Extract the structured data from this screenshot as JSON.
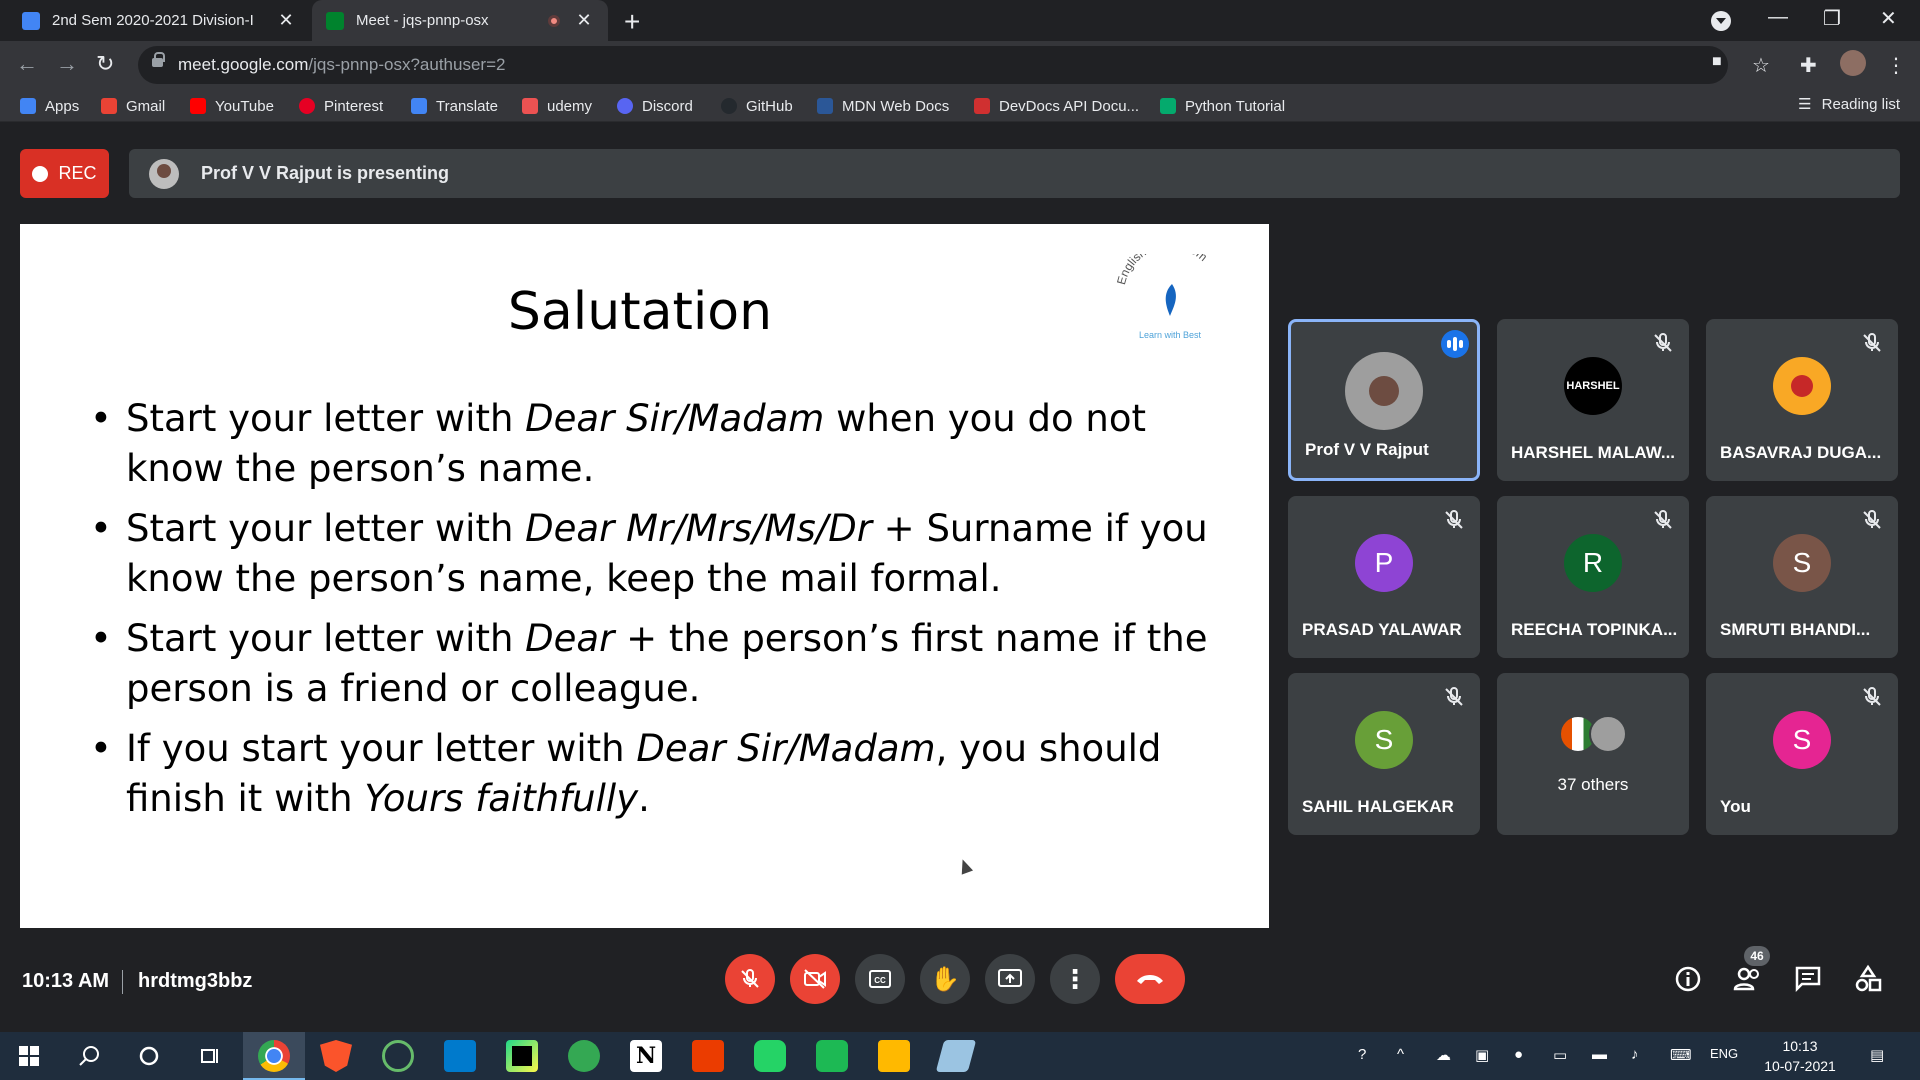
{
  "browser": {
    "tabs": [
      {
        "title": "2nd Sem 2020-2021 Division-I",
        "favicon_color": "#4285f4",
        "active": false
      },
      {
        "title": "Meet - jqs-pnnp-osx",
        "favicon_color": "#00832d",
        "active": true
      }
    ],
    "new_tab_label": "+",
    "url_host": "meet.google.com",
    "url_path": "/jqs-pnnp-osx?authuser=2",
    "bookmarks": [
      {
        "label": "Apps",
        "icon_color": "#4285f4"
      },
      {
        "label": "Gmail",
        "icon_color": "#ea4335"
      },
      {
        "label": "YouTube",
        "icon_color": "#ff0000"
      },
      {
        "label": "Pinterest",
        "icon_color": "#e60023"
      },
      {
        "label": "Translate",
        "icon_color": "#4285f4"
      },
      {
        "label": "udemy",
        "icon_color": "#ec5252"
      },
      {
        "label": "Discord",
        "icon_color": "#5865f2"
      },
      {
        "label": "GitHub",
        "icon_color": "#24292e"
      },
      {
        "label": "MDN Web Docs",
        "icon_color": "#2b5797"
      },
      {
        "label": "DevDocs API Docu...",
        "icon_color": "#d03030"
      },
      {
        "label": "Python Tutorial",
        "icon_color": "#04aa6d"
      }
    ],
    "reading_list": "Reading list"
  },
  "meet": {
    "rec_label": "REC",
    "presenting_text": "Prof V V Rajput is presenting",
    "slide": {
      "title": "Salutation",
      "logo_text": "English Classroom",
      "logo_subtext": "Learn with Best",
      "bullets": [
        {
          "before": "Start your letter with ",
          "italic": "Dear Sir/Madam",
          "after": " when you do not know the person’s name."
        },
        {
          "before": "Start your letter with ",
          "italic": "Dear Mr/Mrs/Ms/Dr",
          "after": " + Surname if you know the person’s name, keep the mail formal."
        },
        {
          "before": "Start your letter with ",
          "italic": "Dear",
          "after": " + the person’s first name if the person is a friend or colleague."
        },
        {
          "before": "If  you start your letter with ",
          "italic": "Dear Sir/Madam",
          "after": ", you should finish it with ",
          "italic2": "Yours faithfully",
          "after2": "."
        }
      ]
    },
    "participants": [
      {
        "name": "Prof V V Rajput",
        "initial": "",
        "color": "#9e9e9e",
        "speaking": true
      },
      {
        "name": "HARSHEL MALAW...",
        "initial": "HARSHEL",
        "color": "#000000",
        "speaking": false
      },
      {
        "name": "BASAVRAJ DUGA...",
        "initial": "",
        "color": "#f9a825",
        "speaking": false
      },
      {
        "name": "PRASAD YALAWAR",
        "initial": "P",
        "color": "#8e44d4",
        "speaking": false
      },
      {
        "name": "REECHA TOPINKA...",
        "initial": "R",
        "color": "#0d652d",
        "speaking": false
      },
      {
        "name": "SMRUTI BHANDI...",
        "initial": "S",
        "color": "#795548",
        "speaking": false
      },
      {
        "name": "SAHIL HALGEKAR",
        "initial": "S",
        "color": "#689f38",
        "speaking": false
      },
      {
        "name": "37 others",
        "initial": "",
        "color": "",
        "speaking": false
      },
      {
        "name": "You",
        "initial": "S",
        "color": "#e52592",
        "speaking": false
      }
    ],
    "time": "10:13 AM",
    "meeting_code": "hrdtmg3bbz",
    "people_count": "46",
    "colors": {
      "accent_blue": "#8ab4f8",
      "danger_red": "#ea4335"
    }
  },
  "taskbar": {
    "language": "ENG",
    "time": "10:13",
    "date": "10-07-2021"
  }
}
